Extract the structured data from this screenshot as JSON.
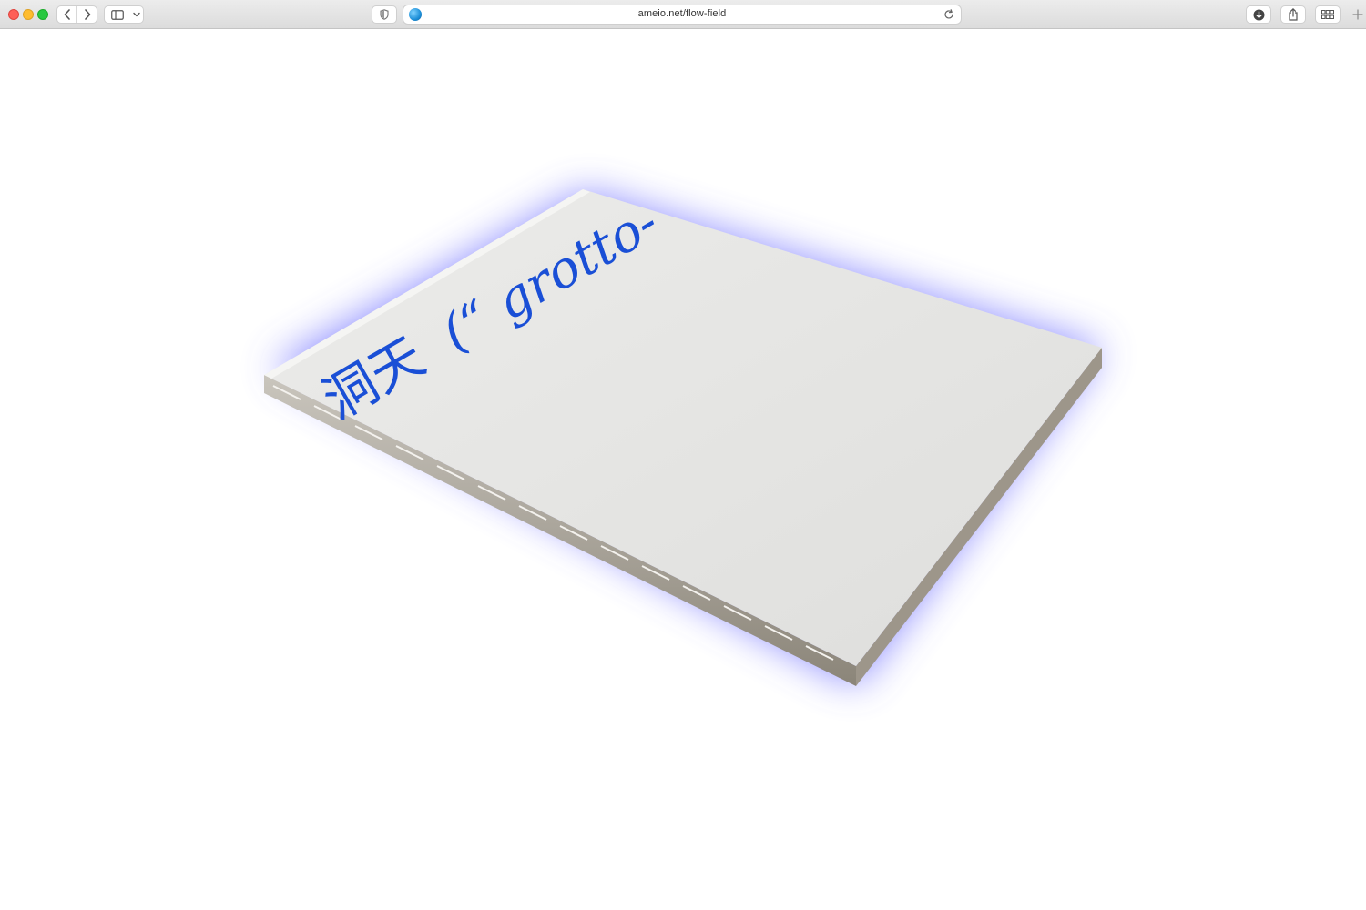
{
  "browser": {
    "url": "ameio.net/flow-field",
    "icons": {
      "back": "chevron-left-icon",
      "forward": "chevron-right-icon",
      "sidebar": "sidebar-icon",
      "sidebar_menu": "chevron-down-icon",
      "privacy": "shield-icon",
      "favicon": "globe-icon",
      "reload": "reload-icon",
      "download": "download-icon",
      "share": "share-icon",
      "tabs": "tab-overview-icon",
      "new_tab": "plus-icon"
    }
  },
  "page": {
    "book_cover": {
      "cjk_title": "洞天",
      "latin_title": "(“ grotto-"
    },
    "colors": {
      "accent_blue": "#1a4fd6",
      "glow": "#5a5cff",
      "cover": "#e6e6e4"
    }
  }
}
